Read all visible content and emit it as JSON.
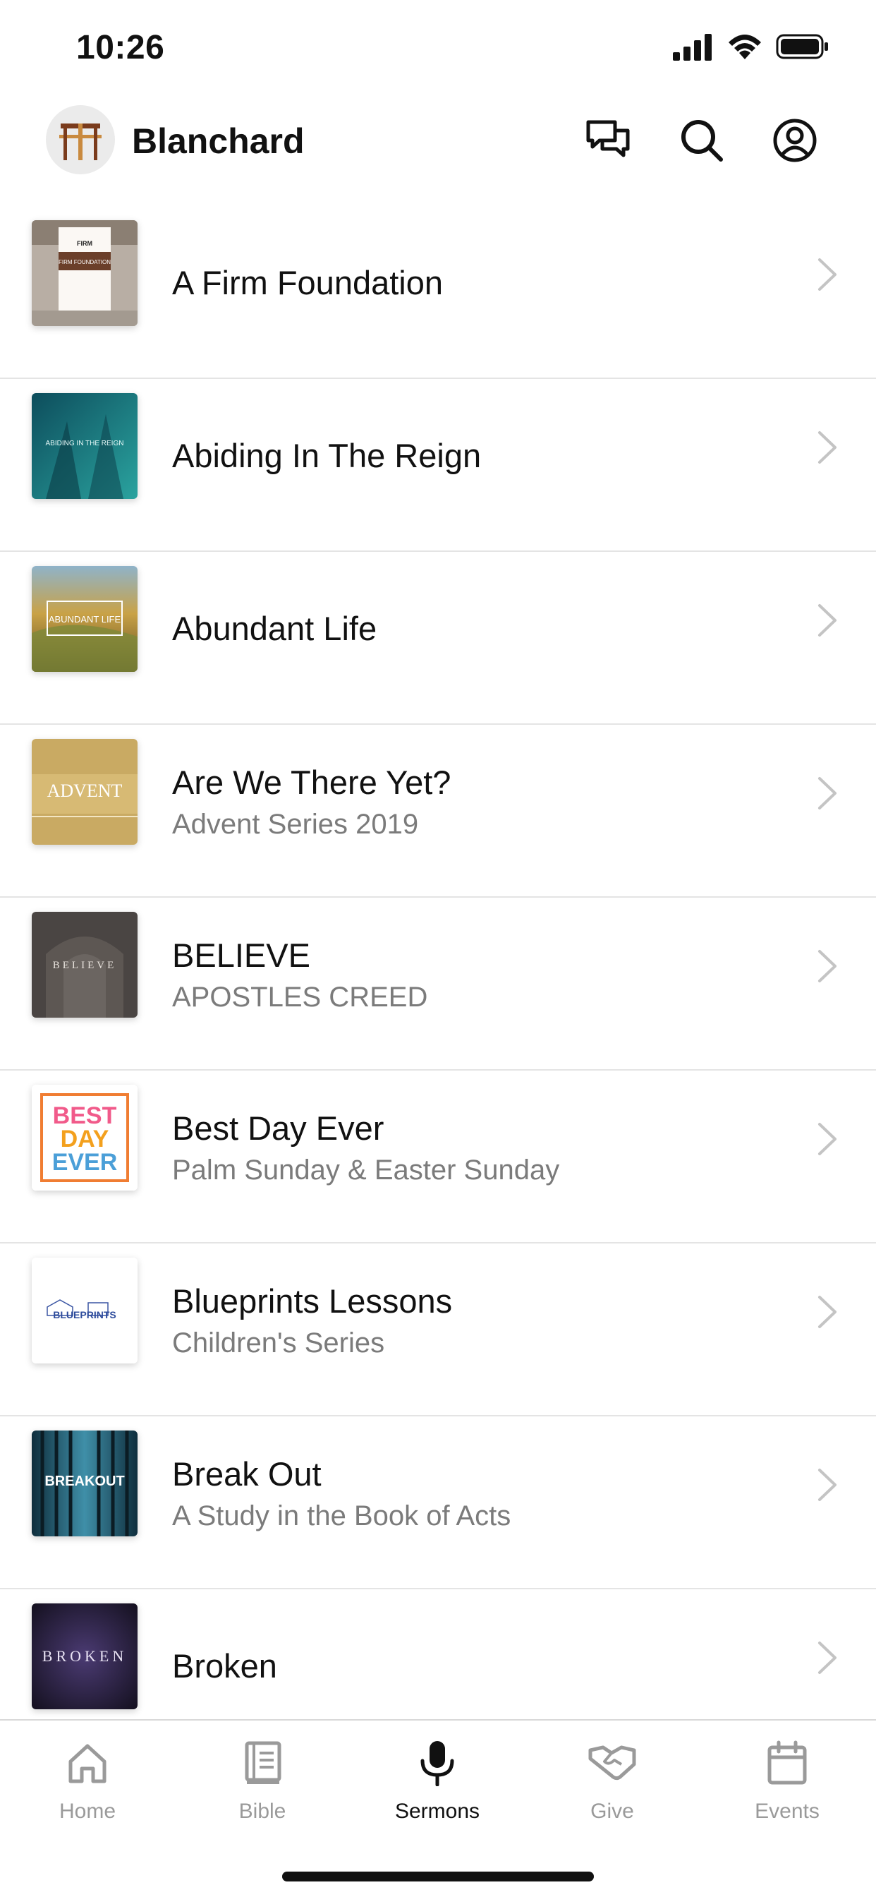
{
  "status_bar": {
    "time": "10:26"
  },
  "header": {
    "title": "Blanchard",
    "icons": [
      "chat-icon",
      "search-icon",
      "profile-icon"
    ]
  },
  "sermons": [
    {
      "title": "A Firm Foundation",
      "subtitle": "",
      "thumb_text": "FIRM FOUNDATION"
    },
    {
      "title": "Abiding In The Reign",
      "subtitle": "",
      "thumb_text": "ABIDING IN THE REIGN"
    },
    {
      "title": "Abundant Life",
      "subtitle": "",
      "thumb_text": "ABUNDANT LIFE"
    },
    {
      "title": "Are We There Yet?",
      "subtitle": "Advent Series 2019",
      "thumb_text": "ADVENT"
    },
    {
      "title": "BELIEVE",
      "subtitle": "APOSTLES CREED",
      "thumb_text": "BELIEVE"
    },
    {
      "title": "Best Day Ever",
      "subtitle": "Palm Sunday & Easter Sunday",
      "thumb_text": "BEST DAY EVER"
    },
    {
      "title": "Blueprints Lessons",
      "subtitle": "Children's Series",
      "thumb_text": "BLUEPRINTS"
    },
    {
      "title": "Break Out",
      "subtitle": "A Study in the Book of Acts",
      "thumb_text": "BREAKOUT"
    },
    {
      "title": "Broken",
      "subtitle": "",
      "thumb_text": "BROKEN"
    }
  ],
  "tabs": [
    {
      "label": "Home",
      "icon": "home-icon",
      "active": false
    },
    {
      "label": "Bible",
      "icon": "bible-icon",
      "active": false
    },
    {
      "label": "Sermons",
      "icon": "microphone-icon",
      "active": true
    },
    {
      "label": "Give",
      "icon": "handshake-icon",
      "active": false
    },
    {
      "label": "Events",
      "icon": "calendar-icon",
      "active": false
    }
  ]
}
